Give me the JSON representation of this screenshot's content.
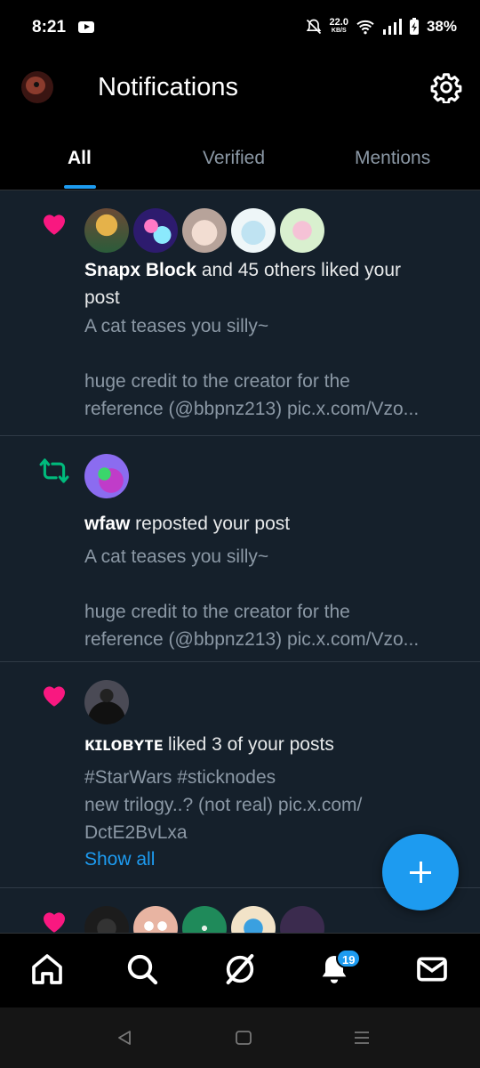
{
  "status_bar": {
    "time": "8:21",
    "speed_value": "22.0",
    "speed_unit": "KB/S",
    "battery": "38%"
  },
  "header": {
    "title": "Notifications",
    "tabs": [
      {
        "label": "All",
        "active": true
      },
      {
        "label": "Verified",
        "active": false
      },
      {
        "label": "Mentions",
        "active": false
      }
    ]
  },
  "notifications": [
    {
      "type": "like",
      "actor": "Snapx Block",
      "action_line1": " and 45 others liked your",
      "action_line2": "post",
      "snippet": [
        "A cat teases you silly~",
        "",
        "huge credit to the creator for the",
        "reference (@bbpnz213) pic.x.com/Vzo..."
      ]
    },
    {
      "type": "repost",
      "actor": "wfaw",
      "action": " reposted your post",
      "snippet": [
        "A cat teases you silly~",
        "",
        "huge credit to the creator for the",
        "reference (@bbpnz213) pic.x.com/Vzo..."
      ]
    },
    {
      "type": "like",
      "actor": "ĸɪʟᴏʙʏᴛᴇ",
      "action": " liked 3 of your posts",
      "snippet": [
        "#StarWars #sticknodes",
        "new trilogy..? (not real) pic.x.com/",
        "DctE2BvLxa"
      ],
      "show_all": "Show all"
    },
    {
      "type": "like"
    }
  ],
  "bottom_nav": {
    "notifications_badge": "19",
    "items": [
      "home-icon",
      "search-icon",
      "grok-icon",
      "notifications-icon",
      "messages-icon"
    ]
  },
  "colors": {
    "accent": "#1d9bf0",
    "like": "#f91880",
    "repost": "#00ba7c",
    "feed_bg": "#15202b"
  }
}
